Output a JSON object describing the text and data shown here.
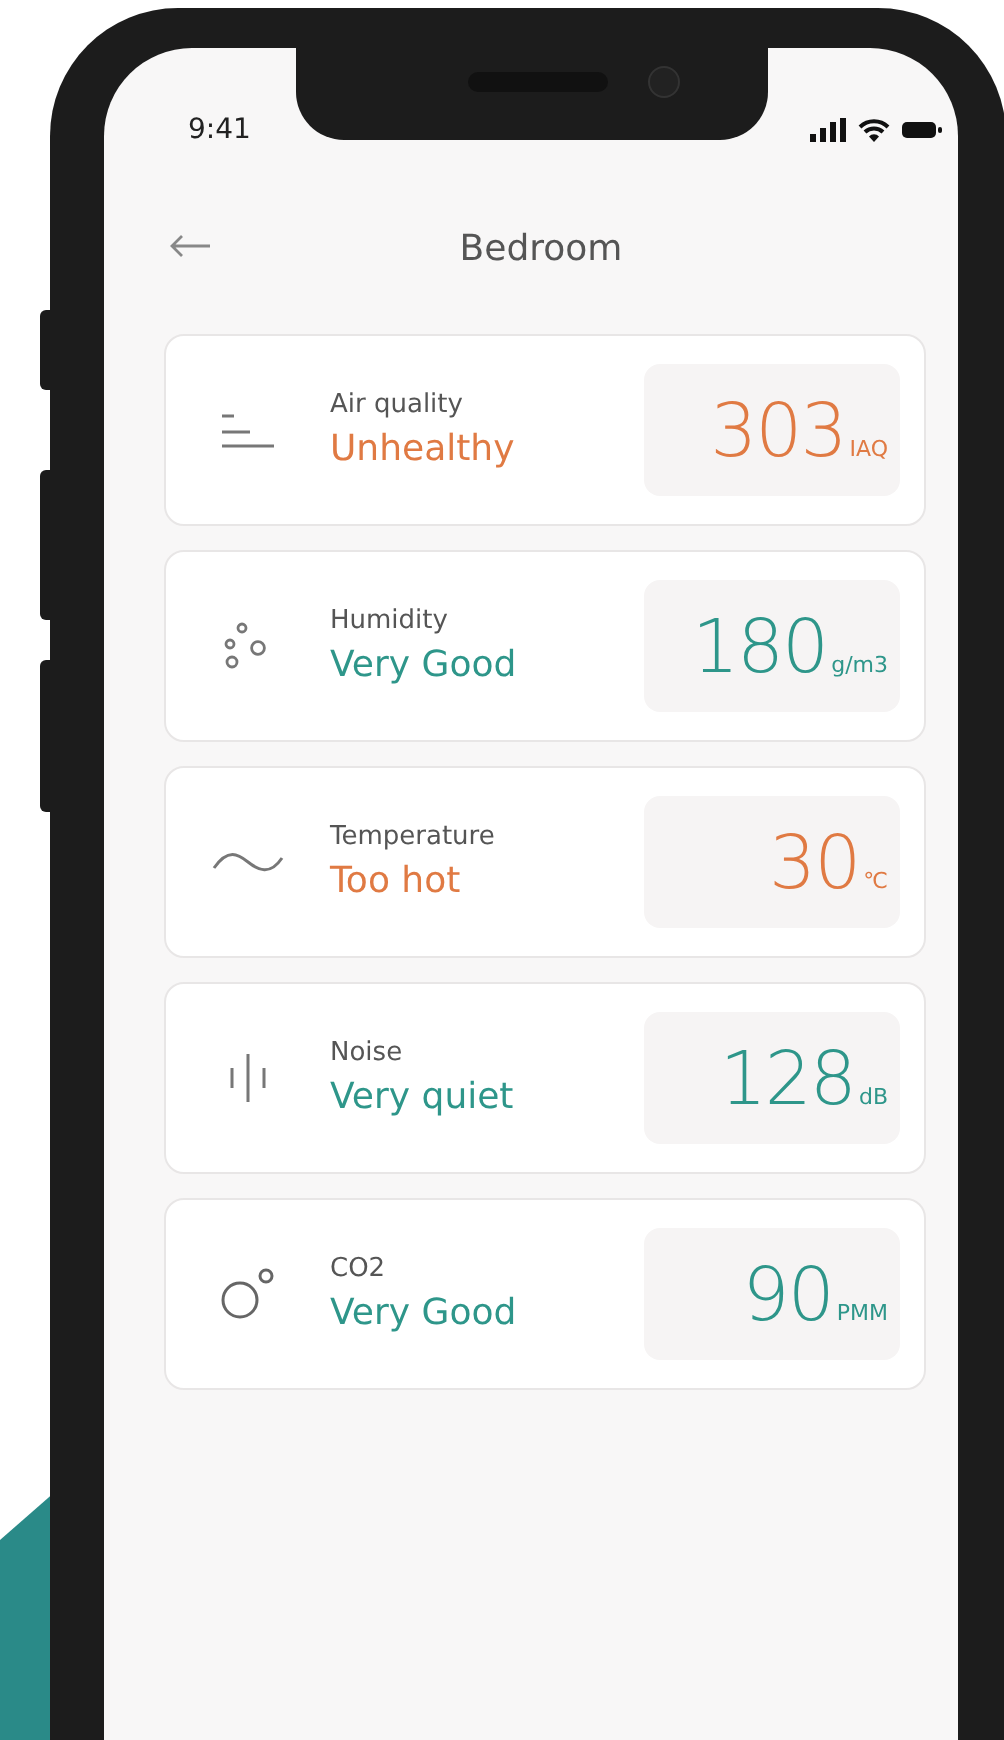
{
  "status_bar": {
    "time": "9:41"
  },
  "header": {
    "title": "Bedroom"
  },
  "metrics": [
    {
      "kind": "air",
      "label": "Air quality",
      "status": "Unhealthy",
      "value": "303",
      "unit": "IAQ",
      "color": "#e07a43"
    },
    {
      "kind": "humidity",
      "label": "Humidity",
      "status": "Very Good",
      "value": "180",
      "unit": "g/m3",
      "color": "#2e968a"
    },
    {
      "kind": "temperature",
      "label": "Temperature",
      "status": "Too hot",
      "value": "30",
      "unit": "℃",
      "color": "#e07a43"
    },
    {
      "kind": "noise",
      "label": "Noise",
      "status": "Very quiet",
      "value": "128",
      "unit": "dB",
      "color": "#2e968a"
    },
    {
      "kind": "co2",
      "label": "CO2",
      "status": "Very Good",
      "value": "90",
      "unit": "PMM",
      "color": "#2e968a"
    }
  ]
}
